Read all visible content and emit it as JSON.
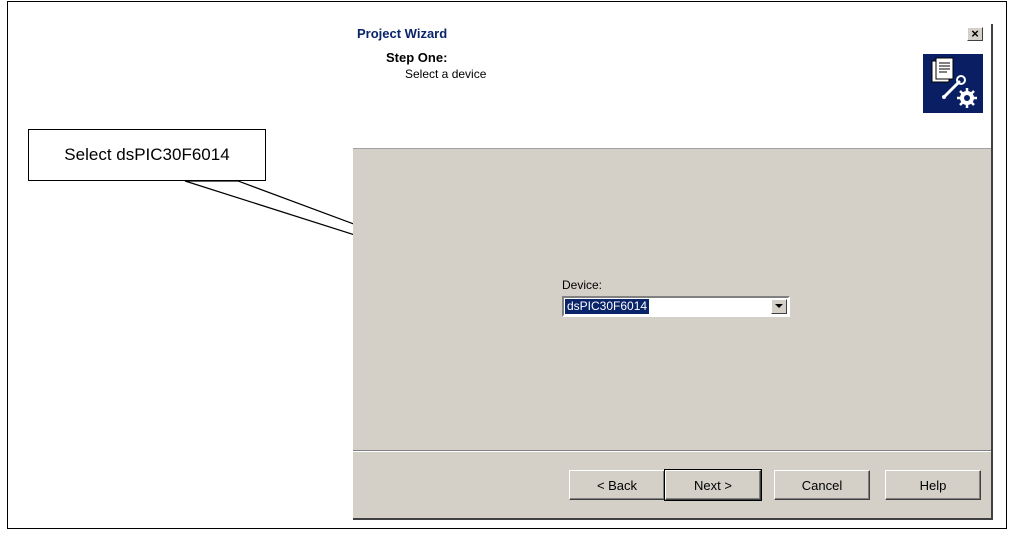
{
  "callout": {
    "text": "Select dsPIC30F6014"
  },
  "dialog": {
    "title": "Project Wizard",
    "close_label": "×",
    "step_title": "Step One:",
    "step_subtitle": "Select a device",
    "icon": "wizard-document-wrench-gear-icon",
    "device_label": "Device:",
    "device_value": "dsPIC30F6014",
    "buttons": {
      "back": "< Back",
      "next": "Next >",
      "cancel": "Cancel",
      "help": "Help"
    }
  }
}
